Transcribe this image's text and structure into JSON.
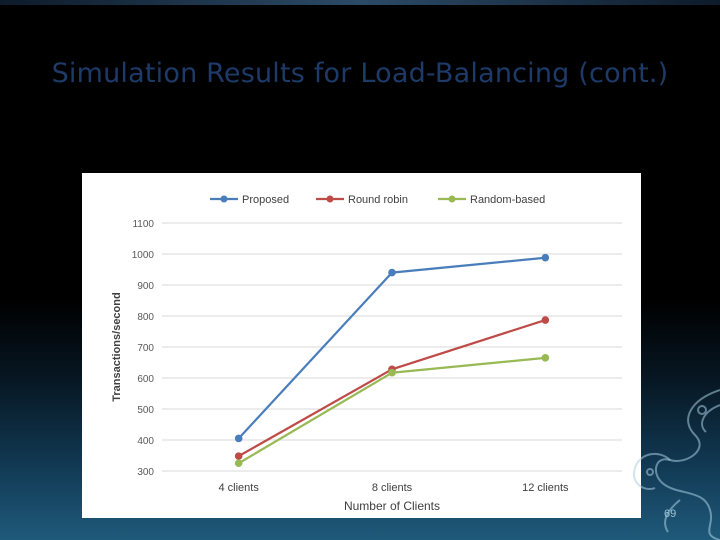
{
  "slide": {
    "title": "Simulation Results for Load-Balancing (cont.)",
    "page_number": "69"
  },
  "colors": {
    "proposed": "#4a7ebb",
    "round_robin": "#be4b48",
    "random_based": "#98b954",
    "title": "#1e3a68"
  },
  "chart_data": {
    "type": "line",
    "title": "",
    "xlabel": "Number of Clients",
    "ylabel": "Transactions/second",
    "categories": [
      "4 clients",
      "8 clients",
      "12 clients"
    ],
    "ylim": [
      300,
      1100
    ],
    "yticks": [
      300,
      400,
      500,
      600,
      700,
      800,
      900,
      1000,
      1100
    ],
    "grid": true,
    "legend_position": "top",
    "series": [
      {
        "name": "Proposed",
        "values": [
          405,
          940,
          988
        ],
        "color": "#4a7ebb"
      },
      {
        "name": "Round robin",
        "values": [
          348,
          628,
          787
        ],
        "color": "#be4b48"
      },
      {
        "name": "Random-based",
        "values": [
          325,
          617,
          665
        ],
        "color": "#98b954"
      }
    ]
  }
}
